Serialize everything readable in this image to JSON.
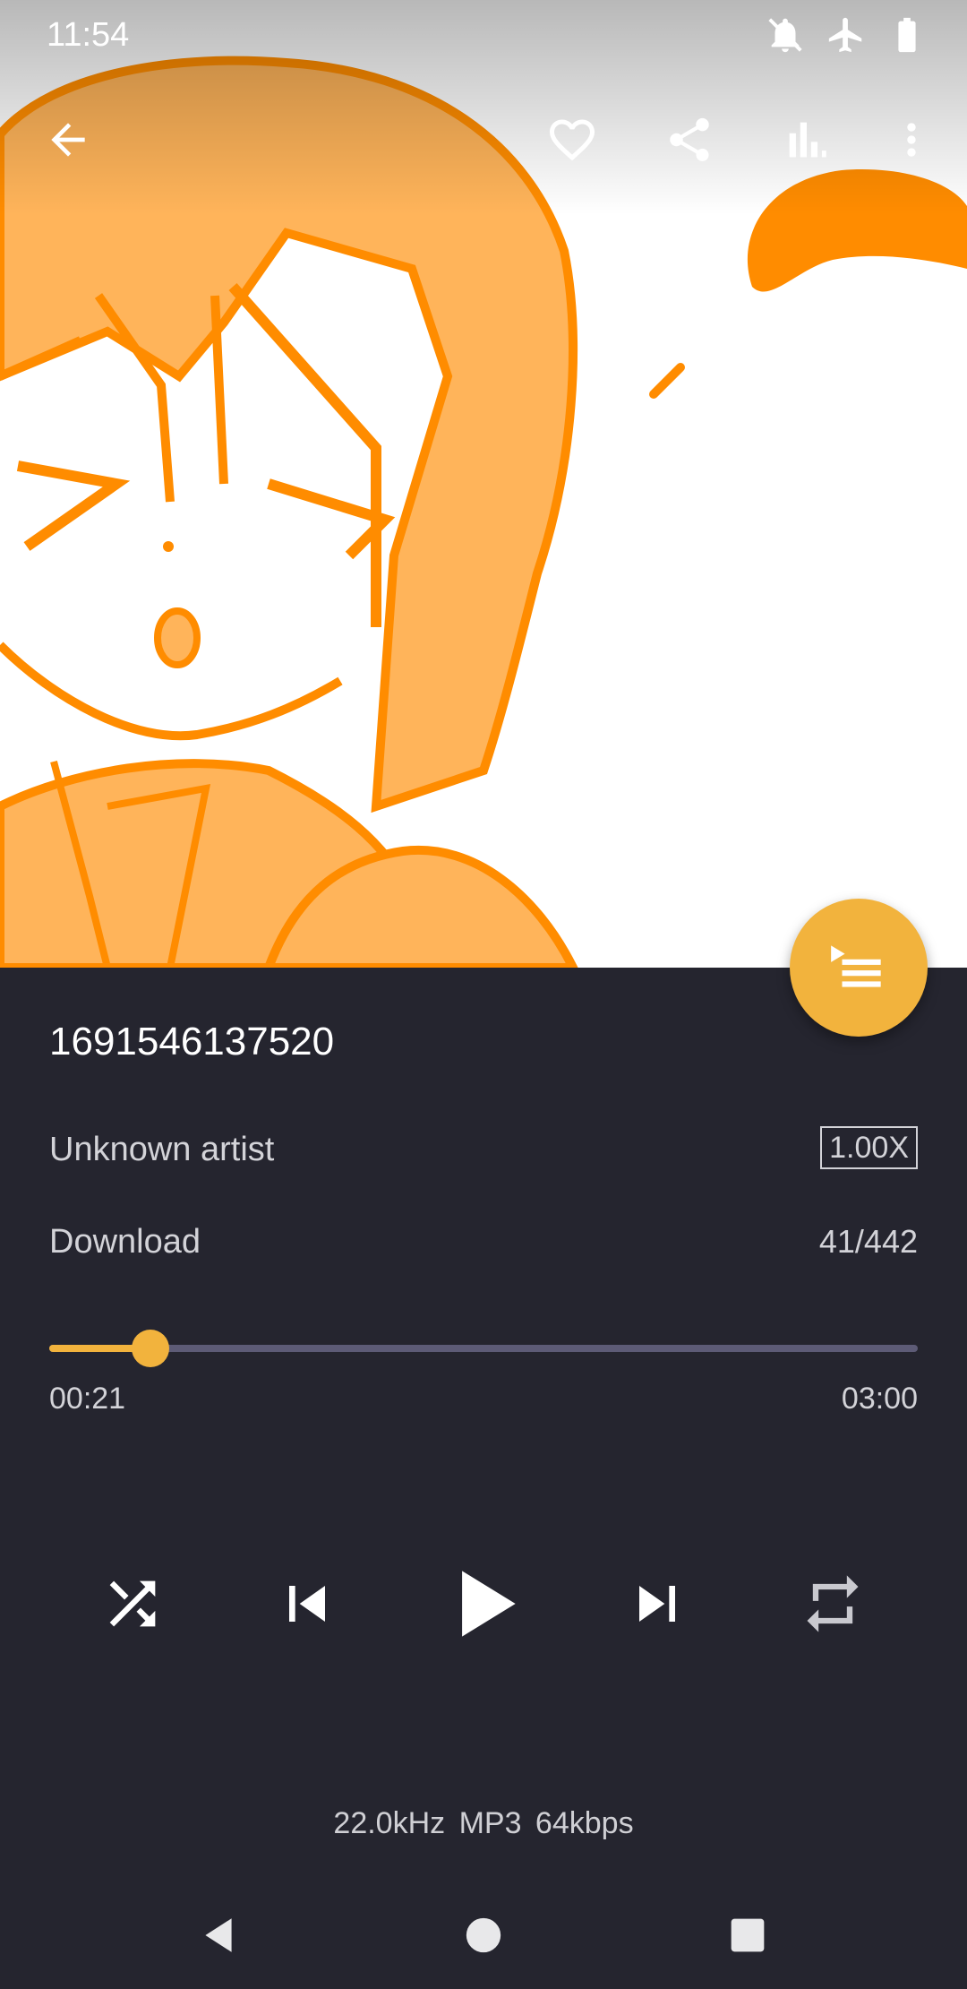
{
  "status_bar": {
    "time": "11:54",
    "icons": [
      "notifications-off-icon",
      "airplane-mode-icon",
      "battery-icon"
    ]
  },
  "toolbar": {
    "icons": [
      "back-arrow-icon",
      "heart-icon",
      "share-icon",
      "equalizer-icon",
      "more-vert-icon"
    ]
  },
  "track": {
    "title": "1691546137520",
    "artist": "Unknown artist",
    "album": "Download",
    "speed": "1.00X",
    "queue_position": "41/442"
  },
  "progress": {
    "current": "00:21",
    "total": "03:00",
    "fraction": 0.117
  },
  "controls": {
    "icons": [
      "shuffle-icon",
      "skip-previous-icon",
      "play-icon",
      "skip-next-icon",
      "repeat-icon"
    ]
  },
  "audio_info": {
    "text": "22.0kHz  MP3  64kbps"
  },
  "nav_bar": {
    "icons": [
      "back-triangle-icon",
      "home-circle-icon",
      "recents-square-icon"
    ]
  },
  "colors": {
    "accent": "#f2b33d",
    "background": "#25252f",
    "artwork_orange": "#ff8c00",
    "artwork_fill": "#ffb45a",
    "track_inactive": "#5d5b76"
  }
}
